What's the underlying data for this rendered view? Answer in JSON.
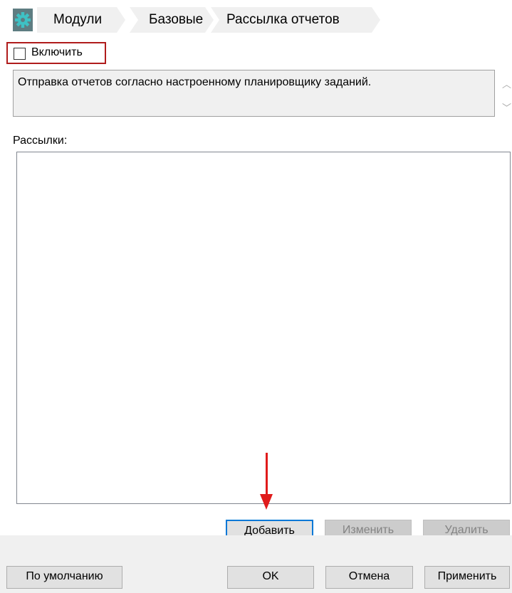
{
  "breadcrumb": {
    "items": [
      {
        "label": "Модули"
      },
      {
        "label": "Базовые"
      },
      {
        "label": "Рассылка отчетов"
      }
    ],
    "icon": "gear-icon",
    "icon_color": "#2a9d9f"
  },
  "enable": {
    "label": "Включить",
    "checked": false,
    "highlight_color": "#b01c1c"
  },
  "description": {
    "text": "Отправка отчетов согласно настроенному планировщику заданий."
  },
  "mailings": {
    "label": "Рассылки:",
    "items": [],
    "buttons": {
      "add": "Добавить",
      "edit": "Изменить",
      "delete": "Удалить"
    }
  },
  "footer": {
    "defaults": "По умолчанию",
    "ok": "OK",
    "cancel": "Отмена",
    "apply": "Применить"
  },
  "annotation": {
    "arrow_color": "#e01b1b"
  }
}
